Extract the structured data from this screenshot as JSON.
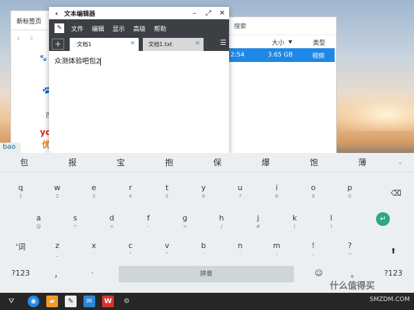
{
  "browser": {
    "tab_label": "新标签页",
    "baidu_caption": "百",
    "youku_line1": "you",
    "youku_line2": "优"
  },
  "files": {
    "search_placeholder": "搜索",
    "columns": [
      "大小",
      "类型"
    ],
    "row": {
      "time": "2:54",
      "size": "3.65 GB",
      "type": "视频"
    }
  },
  "editor": {
    "title": "文本编辑器",
    "menu": [
      "文件",
      "编辑",
      "显示",
      "高级",
      "帮助"
    ],
    "tabs": [
      {
        "label": "·文档1"
      },
      {
        "label": "文档1.txt"
      }
    ],
    "content": "众测体验吧包2"
  },
  "ime": {
    "composition": "bao",
    "candidates": [
      "包",
      "报",
      "宝",
      "抱",
      "保",
      "爆",
      "饱",
      "薄"
    ],
    "rows": [
      [
        [
          "q",
          "1"
        ],
        [
          "w",
          "2"
        ],
        [
          "e",
          "3"
        ],
        [
          "r",
          "4"
        ],
        [
          "t",
          "5"
        ],
        [
          "y",
          "6"
        ],
        [
          "u",
          "7"
        ],
        [
          "i",
          "8"
        ],
        [
          "o",
          "9"
        ],
        [
          "p",
          "0"
        ]
      ],
      [
        [
          "a",
          "@"
        ],
        [
          "s",
          "*"
        ],
        [
          "d",
          "+"
        ],
        [
          "f",
          "-"
        ],
        [
          "g",
          "="
        ],
        [
          "h",
          "/"
        ],
        [
          "j",
          "#"
        ],
        [
          "k",
          "("
        ],
        [
          "l",
          ")"
        ]
      ],
      [
        [
          "'词",
          ""
        ],
        [
          "z",
          "_"
        ],
        [
          "x",
          "-"
        ],
        [
          "c",
          "\""
        ],
        [
          "v",
          "\""
        ],
        [
          "b",
          "'"
        ],
        [
          "n",
          "'"
        ],
        [
          "m",
          ":"
        ],
        [
          "!",
          ";"
        ],
        [
          "?",
          "~"
        ]
      ]
    ],
    "bottom": {
      "sym_left": "?123",
      "comma": "，",
      "space": "拼音",
      "period": "。",
      "sym_right": "?123"
    }
  },
  "watermark": "什么值得买",
  "taskbar_watermark": "SMZDM.COM"
}
